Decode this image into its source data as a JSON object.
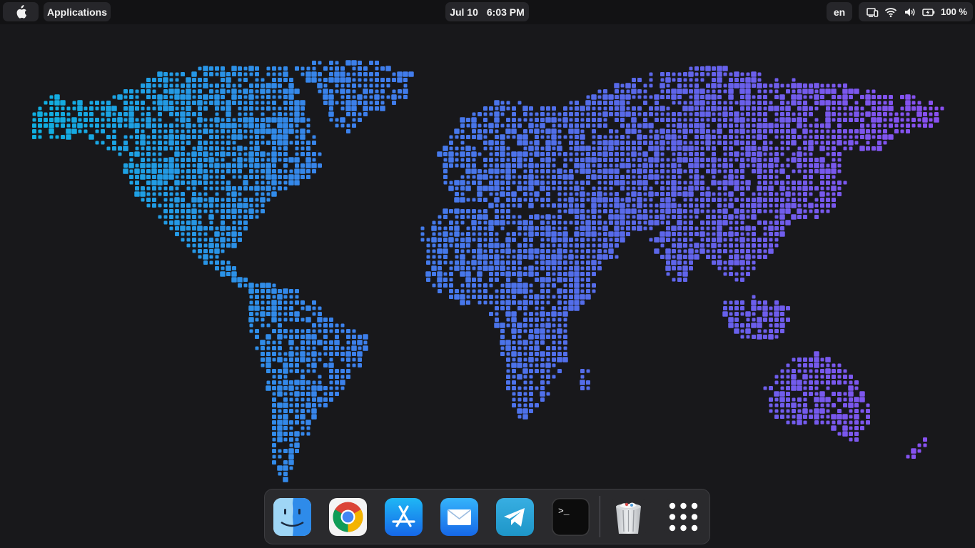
{
  "topbar": {
    "apple_menu_icon": "apple-icon",
    "applications_label": "Applications",
    "date": "Jul 10",
    "time": "6:03 PM",
    "language": "en",
    "status_icons": [
      "cast-icon",
      "wifi-icon",
      "volume-icon",
      "battery-icon"
    ],
    "battery": "100 %"
  },
  "dock": {
    "apps": [
      {
        "name": "Finder",
        "icon": "finder-icon"
      },
      {
        "name": "Chrome",
        "icon": "chrome-icon"
      },
      {
        "name": "App Store",
        "icon": "app-store-icon"
      },
      {
        "name": "Mail",
        "icon": "mail-icon"
      },
      {
        "name": "Telegram",
        "icon": "telegram-icon"
      },
      {
        "name": "Terminal",
        "icon": "terminal-icon",
        "prompt": ">_"
      },
      {
        "name": "Trash",
        "icon": "trash-icon"
      },
      {
        "name": "Applications Grid",
        "icon": "app-grid-icon"
      }
    ]
  },
  "wallpaper": {
    "description_icon": "dotted-world-map",
    "gradient": [
      "#0fb0e0",
      "#3a82ec",
      "#5a68ea",
      "#8b4ff0"
    ]
  },
  "colors": {
    "desktop_bg": "#18181b",
    "topbar_bg": "#121214",
    "pill_bg": "#26262a",
    "dock_bg": "#2a2a2d"
  }
}
